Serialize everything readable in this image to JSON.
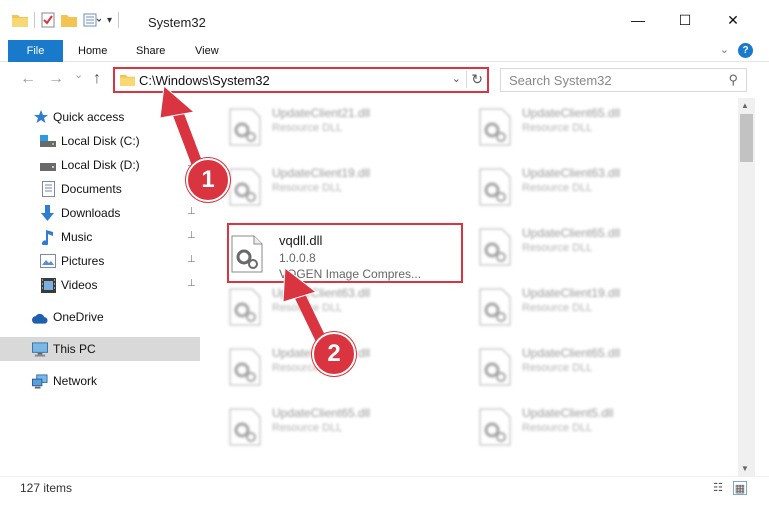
{
  "window": {
    "title": "System32",
    "minimize_glyph": "—",
    "maximize_glyph": "☐",
    "close_glyph": "✕"
  },
  "ribbon": {
    "tabs": [
      {
        "label": "File"
      },
      {
        "label": "Home"
      },
      {
        "label": "Share"
      },
      {
        "label": "View"
      }
    ],
    "help_glyph": "?",
    "collapse_glyph": "⌄"
  },
  "nav": {
    "back_glyph": "←",
    "forward_glyph": "→",
    "recent_glyph": "⌄",
    "up_glyph": "↑",
    "address": "C:\\Windows\\System32",
    "address_dropdown_glyph": "⌄",
    "refresh_glyph": "↻",
    "search_placeholder": "Search System32",
    "search_glyph": "⚲"
  },
  "sidebar": {
    "items": [
      {
        "label": "Quick access",
        "icon": "star-icon",
        "pinned": false
      },
      {
        "label": "Local Disk (C:)",
        "icon": "drive-icon",
        "pinned": true
      },
      {
        "label": "Local Disk (D:)",
        "icon": "drive-icon",
        "pinned": true
      },
      {
        "label": "Documents",
        "icon": "documents-icon",
        "pinned": true
      },
      {
        "label": "Downloads",
        "icon": "downloads-icon",
        "pinned": true
      },
      {
        "label": "Music",
        "icon": "music-icon",
        "pinned": true
      },
      {
        "label": "Pictures",
        "icon": "pictures-icon",
        "pinned": true
      },
      {
        "label": "Videos",
        "icon": "videos-icon",
        "pinned": true
      },
      {
        "label": "OneDrive",
        "icon": "cloud-icon",
        "pinned": false
      },
      {
        "label": "This PC",
        "icon": "computer-icon",
        "pinned": false,
        "selected": true
      },
      {
        "label": "Network",
        "icon": "network-icon",
        "pinned": false
      }
    ],
    "pin_glyph": "📌"
  },
  "files": {
    "left": [
      {
        "name": "UpdateClient21.dll",
        "type": "Resource DLL"
      },
      {
        "name": "UpdateClient19.dll",
        "type": "Resource DLL"
      },
      {
        "name": "UpdateClient63.dll",
        "type": "Resource DLL"
      },
      {
        "name": "UpdateClient63.dll",
        "type": "Resource DLL"
      },
      {
        "name": "UpdateClient65.dll",
        "type": "Resource DLL"
      }
    ],
    "right": [
      {
        "name": "UpdateClient65.dll",
        "type": "Resource DLL"
      },
      {
        "name": "UpdateClient63.dll",
        "type": "Resource DLL"
      },
      {
        "name": "UpdateClient65.dll",
        "type": "Resource DLL"
      },
      {
        "name": "UpdateClient19.dll",
        "type": "Resource DLL"
      },
      {
        "name": "UpdateClient65.dll",
        "type": "Resource DLL"
      },
      {
        "name": "UpdateClient5.dll",
        "type": "Resource DLL"
      }
    ],
    "selected": {
      "name": "vqdll.dll",
      "version": "1.0.0.8",
      "description": "VOGEN Image Compres..."
    }
  },
  "status": {
    "item_count": "127 items"
  },
  "annotations": {
    "step1": "1",
    "step2": "2",
    "color": "#d9343f"
  }
}
